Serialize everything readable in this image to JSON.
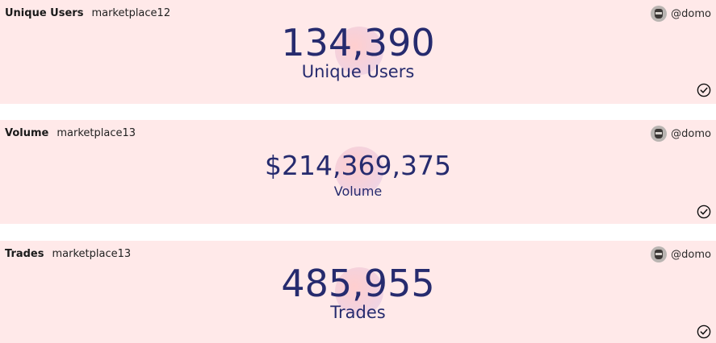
{
  "author": "@domo",
  "cards": [
    {
      "title": "Unique Users",
      "query": "marketplace12",
      "value": "134,390",
      "label": "Unique Users"
    },
    {
      "title": "Volume",
      "query": "marketplace13",
      "value": "$214,369,375",
      "label": "Volume"
    },
    {
      "title": "Trades",
      "query": "marketplace13",
      "value": "485,955",
      "label": "Trades"
    }
  ],
  "colors": {
    "card_background": "#ffe9e9",
    "metric_text": "#262b6e",
    "page_background": "#ffffff"
  },
  "icons": {
    "avatar": "avatar-icon",
    "status": "check-circle-icon"
  }
}
